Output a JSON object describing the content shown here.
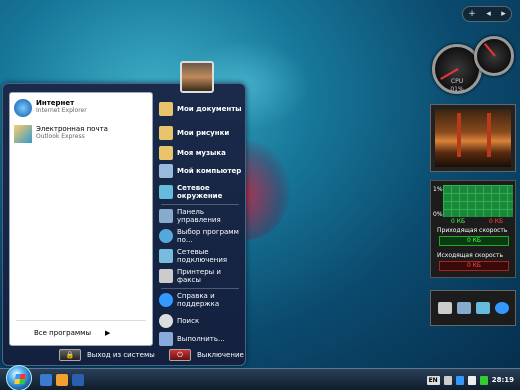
{
  "sidebar": {
    "top_controls": {
      "add": "+",
      "prev": "◂",
      "next": "▸"
    }
  },
  "gadgets": {
    "gauges": {
      "cpu_label": "CPU",
      "cpu_value": "01%"
    },
    "network": {
      "scale_top": "1%",
      "scale_bottom": "0%",
      "left_val": "0 КБ",
      "right_val": "0 КБ",
      "download_label": "Приходящая скорость",
      "download_val": "0 КБ",
      "upload_label": "Исходящая скорость",
      "upload_val": "0 КБ"
    }
  },
  "start_menu": {
    "pinned": [
      {
        "title": "Интернет",
        "sub": "Internet Explorer",
        "icon": "internet-explorer-icon"
      },
      {
        "title": "Электронная почта",
        "sub": "Outlook Express",
        "icon": "outlook-express-icon"
      }
    ],
    "all_programs": "Все программы",
    "right": [
      {
        "label": "Мои документы",
        "icon": "folder-documents-icon"
      },
      {
        "label": "Мои рисунки",
        "icon": "folder-pictures-icon"
      },
      {
        "label": "Моя музыка",
        "icon": "folder-music-icon"
      },
      {
        "label": "Мой компьютер",
        "icon": "computer-icon"
      },
      {
        "label": "Сетевое окружение",
        "icon": "network-places-icon"
      },
      {
        "label": "Панель управления",
        "icon": "control-panel-icon"
      },
      {
        "label": "Выбор программ по...",
        "icon": "program-defaults-icon"
      },
      {
        "label": "Сетевые подключения",
        "icon": "network-connections-icon"
      },
      {
        "label": "Принтеры и факсы",
        "icon": "printers-icon"
      },
      {
        "label": "Справка и поддержка",
        "icon": "help-icon"
      },
      {
        "label": "Поиск",
        "icon": "search-icon"
      },
      {
        "label": "Выполнить...",
        "icon": "run-icon"
      }
    ],
    "logoff": "Выход из системы",
    "shutdown": "Выключение"
  },
  "taskbar": {
    "lang": "EN",
    "clock": "28:19"
  },
  "colors": {
    "accent": "#1a5fa8",
    "panel": "#1b2a4a",
    "graph": "#1a8a3a"
  }
}
